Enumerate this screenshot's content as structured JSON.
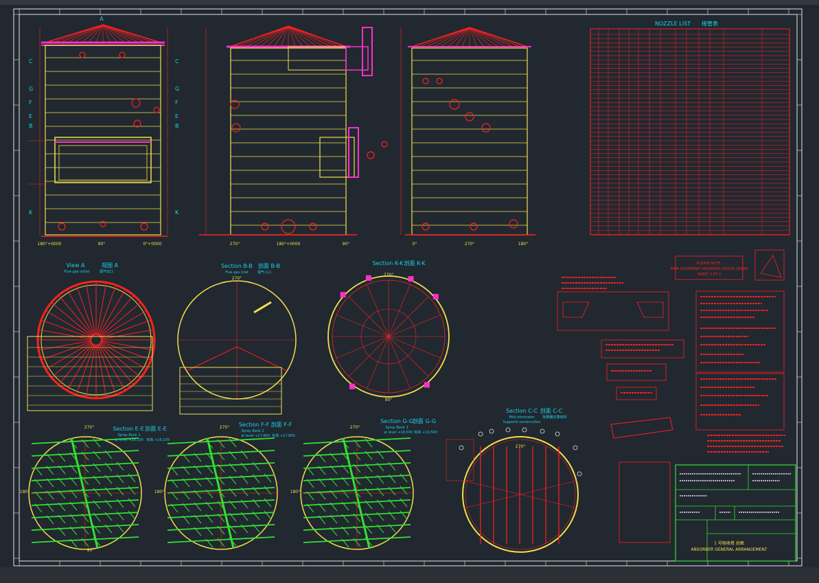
{
  "colors": {
    "background": "#212830",
    "red": "#ff2020",
    "yellow": "#f4e04a",
    "green": "#33e033",
    "magenta": "#ff30c8",
    "cyan": "#19d3e8",
    "white": "#e8e8e8"
  },
  "elevation_views": {
    "view1": {
      "left_tag": "180°+0000",
      "mid_tag": "90°",
      "right_tag": "0°+0000",
      "top_tag": "A"
    },
    "view2": {
      "left_tag": "270°",
      "mid_tag": "180°+0000",
      "right_tag": "90°"
    },
    "view3": {
      "left_tag": "0°",
      "mid_tag": "270°",
      "right_tag": "180°"
    },
    "section_marks": [
      "C",
      "G",
      "F",
      "E",
      "B",
      "K"
    ]
  },
  "sections": {
    "view_a": {
      "title": "View A",
      "title_cn": "视图 A",
      "subtitle": "Flue gas outlet",
      "subtitle_cn": "烟气出口"
    },
    "section_bb": {
      "title": "Section B-B",
      "title_cn": "剖面 B-B",
      "subtitle": "Flue gas inlet",
      "subtitle_cn": "烟气入口",
      "top": "270°"
    },
    "section_kk": {
      "title": "Section K-K",
      "title_cn": "剖面 K-K",
      "top": "270°",
      "bottom": "90°"
    },
    "section_ee": {
      "title": "Section E-E",
      "title_cn": "剖面 E-E",
      "line1": "Spray Bank 1",
      "line2": "at level +16,100",
      "line2_cn": "标高 +16,100",
      "top": "270°",
      "left": "180°",
      "bottom": "90°"
    },
    "section_ff": {
      "title": "Section F-F",
      "title_cn": "剖面 F-F",
      "line1": "Spray Bank 2",
      "line2": "at level +17,800",
      "line2_cn": "标高 +17,800",
      "top": "270°",
      "left": "180°"
    },
    "section_gg": {
      "title": "Section G-G",
      "title_cn": "剖面 G-G",
      "line1": "Spray Bank 3",
      "line2": "at level +19,500",
      "line2_cn": "标高 +19,500",
      "top": "270°",
      "left": "180°"
    },
    "section_cc": {
      "title": "Section C-C",
      "title_cn": "剖面 C-C",
      "line1": "Mist eliminator",
      "line2": "Supports construction",
      "line1_cn": "除雾器支撑结构",
      "top": "270°"
    }
  },
  "nozzle_list": {
    "title": "NOZZLE LIST",
    "title_cn": "接管表"
  },
  "tolerance_box": {
    "line1": "PLEASE NOTE:",
    "line2": "MAIN EQUIPMENT ABSORBER DESIGN SERIES",
    "line3": "SHEET 2 OF 2"
  },
  "title_block": {
    "drawing_no": "1 号吸收塔 总图",
    "subtitle": "ABSORBER GENERAL ARRANGEMENT"
  }
}
